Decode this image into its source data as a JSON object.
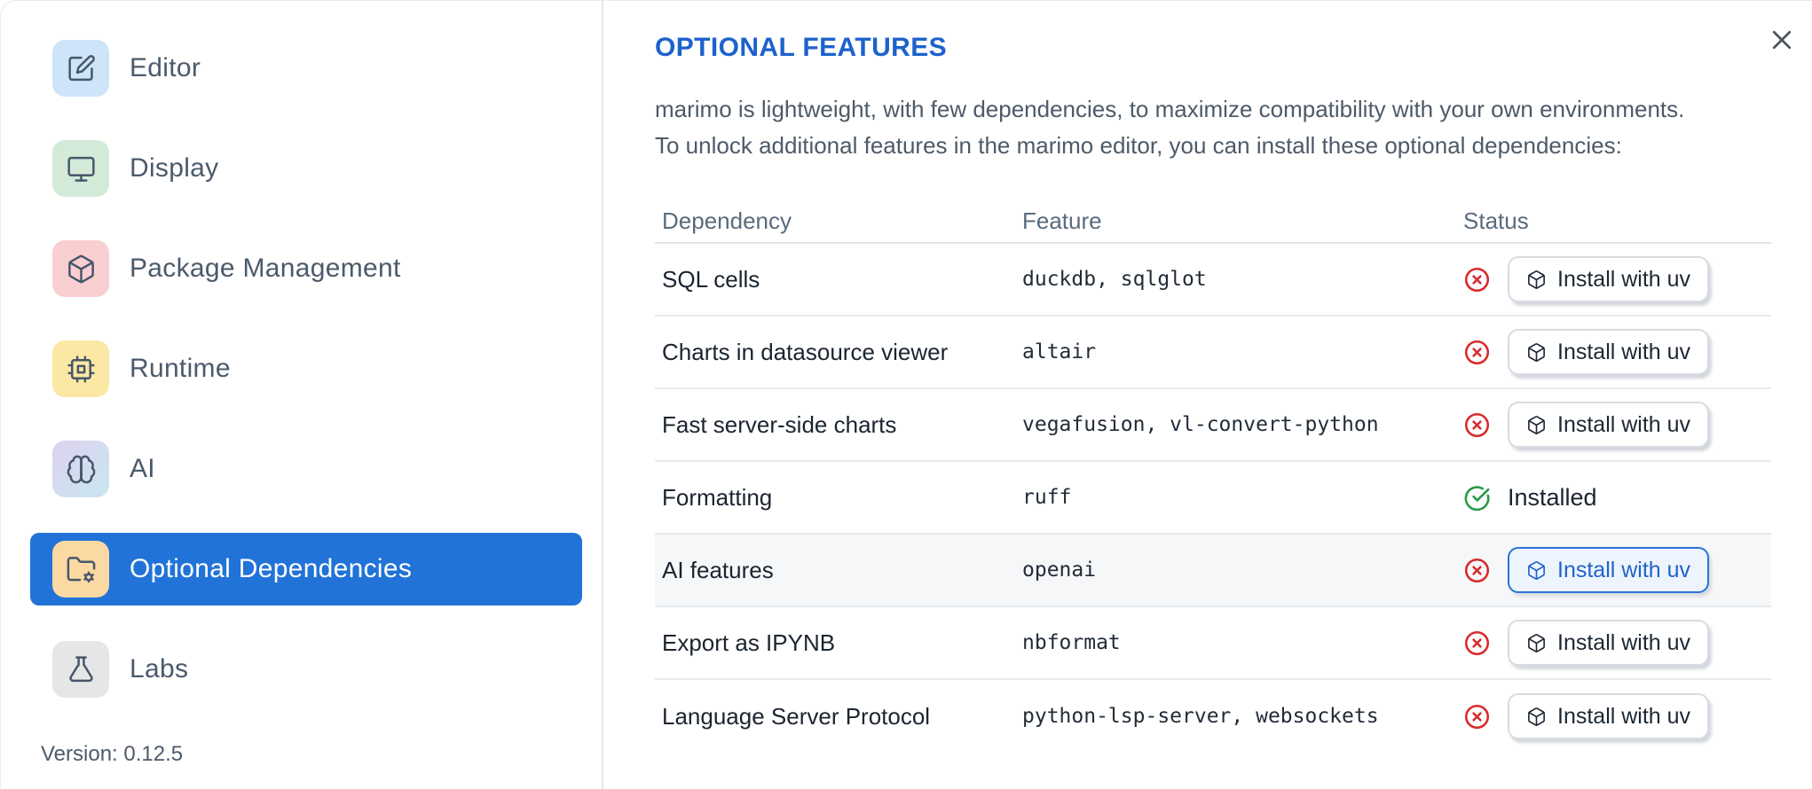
{
  "sidebar": {
    "items": [
      {
        "label": "Editor",
        "icon": "edit-icon",
        "icon_bg": "#cde4f9",
        "selected": false
      },
      {
        "label": "Display",
        "icon": "monitor-icon",
        "icon_bg": "#d4ead8",
        "selected": false
      },
      {
        "label": "Package Management",
        "icon": "package-icon",
        "icon_bg": "#facfd2",
        "selected": false
      },
      {
        "label": "Runtime",
        "icon": "cpu-icon",
        "icon_bg": "#fae8a4",
        "selected": false
      },
      {
        "label": "AI",
        "icon": "brain-icon",
        "icon_bg": "linear-gradient(135deg,#ded2f1 0%,#c8e7ef 100%)",
        "selected": false
      },
      {
        "label": "Optional Dependencies",
        "icon": "folder-cog-icon",
        "icon_bg": "#fbd9a2",
        "selected": true
      },
      {
        "label": "Labs",
        "icon": "flask-icon",
        "icon_bg": "#e5e6e8",
        "selected": false
      }
    ],
    "version_label": "Version: 0.12.5"
  },
  "main": {
    "title": "OPTIONAL FEATURES",
    "description_line1": "marimo is lightweight, with few dependencies, to maximize compatibility with your own environments.",
    "description_line2": "To unlock additional features in the marimo editor, you can install these optional dependencies:",
    "close_icon": "close-icon",
    "table": {
      "columns": [
        "Dependency",
        "Feature",
        "Status"
      ],
      "rows": [
        {
          "dependency": "SQL cells",
          "feature": "duckdb, sqlglot",
          "status": "missing",
          "status_icon": "x-circle-icon",
          "action_label": "Install with uv",
          "highlighted": false,
          "focused": false
        },
        {
          "dependency": "Charts in datasource viewer",
          "feature": "altair",
          "status": "missing",
          "status_icon": "x-circle-icon",
          "action_label": "Install with uv",
          "highlighted": false,
          "focused": false
        },
        {
          "dependency": "Fast server-side charts",
          "feature": "vegafusion, vl-convert-python",
          "status": "missing",
          "status_icon": "x-circle-icon",
          "action_label": "Install with uv",
          "highlighted": false,
          "focused": false
        },
        {
          "dependency": "Formatting",
          "feature": "ruff",
          "status": "installed",
          "status_icon": "check-circle-icon",
          "installed_label": "Installed",
          "highlighted": false,
          "focused": false
        },
        {
          "dependency": "AI features",
          "feature": "openai",
          "status": "missing",
          "status_icon": "x-circle-icon",
          "action_label": "Install with uv",
          "highlighted": true,
          "focused": true
        },
        {
          "dependency": "Export as IPYNB",
          "feature": "nbformat",
          "status": "missing",
          "status_icon": "x-circle-icon",
          "action_label": "Install with uv",
          "highlighted": false,
          "focused": false
        },
        {
          "dependency": "Language Server Protocol",
          "feature": "python-lsp-server, websockets",
          "status": "missing",
          "status_icon": "x-circle-icon",
          "action_label": "Install with uv",
          "highlighted": false,
          "focused": false
        }
      ],
      "button_icon": "package-icon"
    }
  },
  "colors": {
    "selection_blue": "#2173d8",
    "heading_blue": "#1d62cc",
    "status_red": "#d92b2b",
    "status_green": "#259a47",
    "focused_button_border": "#2b72d8",
    "focused_button_bg": "#edf4fd",
    "focused_button_text": "#2063c8",
    "row_highlight": "#f6f7f8",
    "divider": "#e2e6ea"
  }
}
